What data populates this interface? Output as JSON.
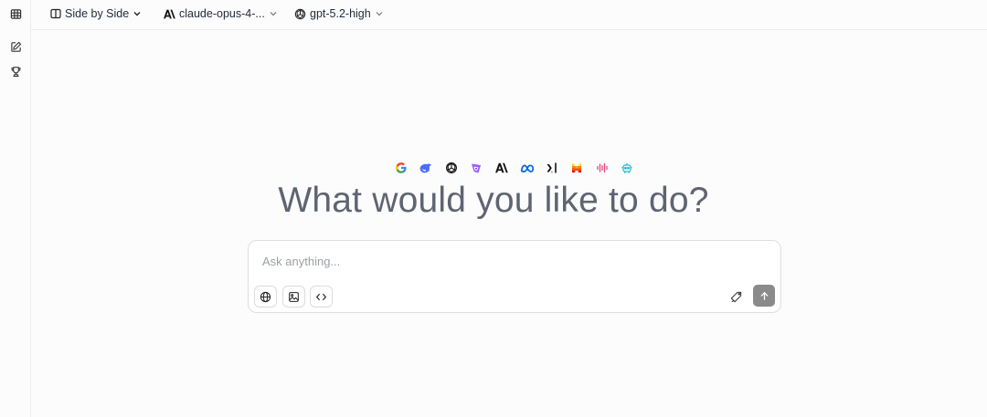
{
  "rail": {
    "items": [
      {
        "name": "table-icon"
      },
      {
        "name": "new-chat-icon"
      },
      {
        "name": "trophy-icon"
      }
    ]
  },
  "topbar": {
    "mode_label": "Side by Side",
    "model_a_label": "claude-opus-4-...",
    "model_b_label": "gpt-5.2-high"
  },
  "providers": [
    {
      "name": "google-icon",
      "color": "#4285F4"
    },
    {
      "name": "deepseek-icon",
      "color": "#4D6BFE"
    },
    {
      "name": "openai-icon",
      "color": "#111111"
    },
    {
      "name": "mistral-like-icon",
      "color": "#7C3AED"
    },
    {
      "name": "anthropic-icon",
      "color": "#111111"
    },
    {
      "name": "meta-icon",
      "color": "#0668E1"
    },
    {
      "name": "xai-icon",
      "color": "#111111"
    },
    {
      "name": "mistral-icon",
      "color": "#F54E1E"
    },
    {
      "name": "waveform-icon",
      "color": "#E0457B"
    },
    {
      "name": "robot-icon",
      "color": "#22B8CF"
    }
  ],
  "headline": "What would you like to do?",
  "composer": {
    "placeholder": "Ask anything...",
    "value": ""
  },
  "colors": {
    "headline": "#5f6472",
    "send_button": "#8a8a8a",
    "border": "#dedede"
  }
}
